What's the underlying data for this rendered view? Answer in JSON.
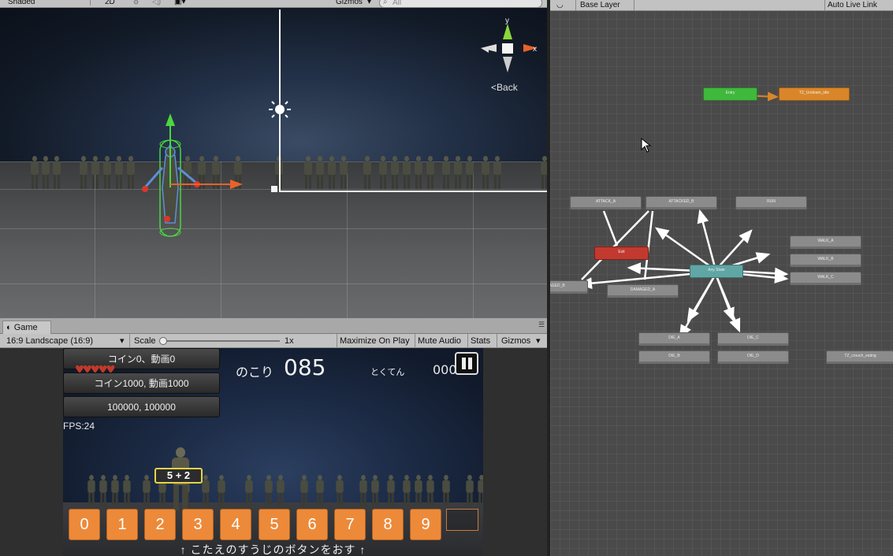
{
  "scene": {
    "shading": "Shaded",
    "mode_2d": "2D",
    "gizmos": "Gizmos",
    "search_placeholder": "All",
    "axis": {
      "y": "y",
      "x": "x",
      "back": "Back"
    }
  },
  "game": {
    "tab": "Game",
    "resolution": "16:9 Landscape (16:9)",
    "scale_label": "Scale",
    "scale_value": "1x",
    "maximize": "Maximize On Play",
    "mute": "Mute Audio",
    "stats": "Stats",
    "gizmos": "Gizmos",
    "hearts": "♥♥♥♥♥",
    "debug_buttons": [
      "コイン0、動画0",
      "コイン1000, 動画1000",
      "100000, 100000"
    ],
    "fps": "FPS:24",
    "nokori_label": "のこり",
    "nokori_value": "085",
    "tokuten_label": "とくてん",
    "tokuten_value": "000",
    "equation": "5 + 2",
    "number_buttons": [
      "0",
      "1",
      "2",
      "3",
      "4",
      "5",
      "6",
      "7",
      "8",
      "9"
    ],
    "instruction": "↑ こたえのすうじのボタンをおす ↑"
  },
  "animator": {
    "layer": "Base Layer",
    "auto_live_link": "Auto Live Link",
    "nodes": {
      "entry": "Entry",
      "idle": "TZ_Undeam_idle",
      "attack_a": "ATTACK_A",
      "attacked_b": "ATTACKED_B",
      "run": "RUN",
      "exit": "Exit",
      "any_state": "Any State",
      "walk_a": "WALK_A",
      "walk_b": "WALK_B",
      "walk_c": "WALK_C",
      "damaged_b": "DAMAGED_B",
      "damaged_a": "DAMAGED_A",
      "die_a": "DIE_A",
      "die_b": "DIE_B",
      "die_c": "DIE_C",
      "die_d": "DIE_D",
      "crouch": "TZ_crouch_eating"
    }
  }
}
